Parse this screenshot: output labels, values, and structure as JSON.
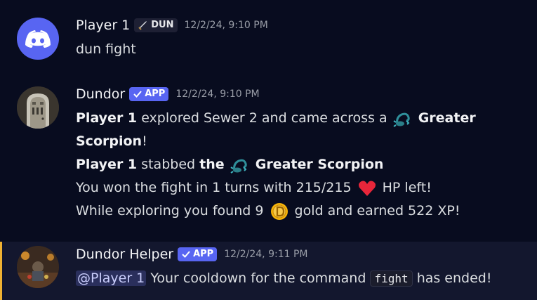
{
  "messages": [
    {
      "author": "Player 1",
      "tag": "DUN",
      "timestamp": "12/2/24, 9:10 PM",
      "content": "dun fight"
    },
    {
      "author": "Dundor",
      "tag": "APP",
      "timestamp": "12/2/24, 9:10 PM",
      "lines": {
        "l1": {
          "player": "Player 1",
          "text1": "explored Sewer 2 and came across a",
          "monster": "Greater"
        },
        "l2": {
          "monster": "Scorpion",
          "text": "!"
        },
        "l3": {
          "player": "Player 1",
          "text": "stabbed",
          "the": "the",
          "monster": "Greater Scorpion"
        },
        "l4": {
          "text1": "You won the fight in 1 turns with 215/215",
          "text2": "HP left!"
        },
        "l5": {
          "text1": "While exploring you found 9",
          "text2": "gold and earned 522 XP!"
        }
      }
    },
    {
      "author": "Dundor Helper",
      "tag": "APP",
      "timestamp": "12/2/24, 9:11 PM",
      "mention": "@Player 1",
      "text1": "Your cooldown for the command",
      "command": "fight",
      "text2": "has ended!"
    }
  ],
  "icons": {
    "guild_tag_icon": "sword-icon",
    "app_check": "checkmark-icon",
    "monster": "scorpion-icon",
    "heart": "heart-icon",
    "gold": "coin-icon",
    "avatar1": "discord-logo-icon"
  },
  "colors": {
    "background": "#080c1f",
    "app_tag": "#5865f2",
    "highlight_bar": "#f0b232",
    "heart": "#e8263a",
    "coin": "#f5b30b"
  }
}
